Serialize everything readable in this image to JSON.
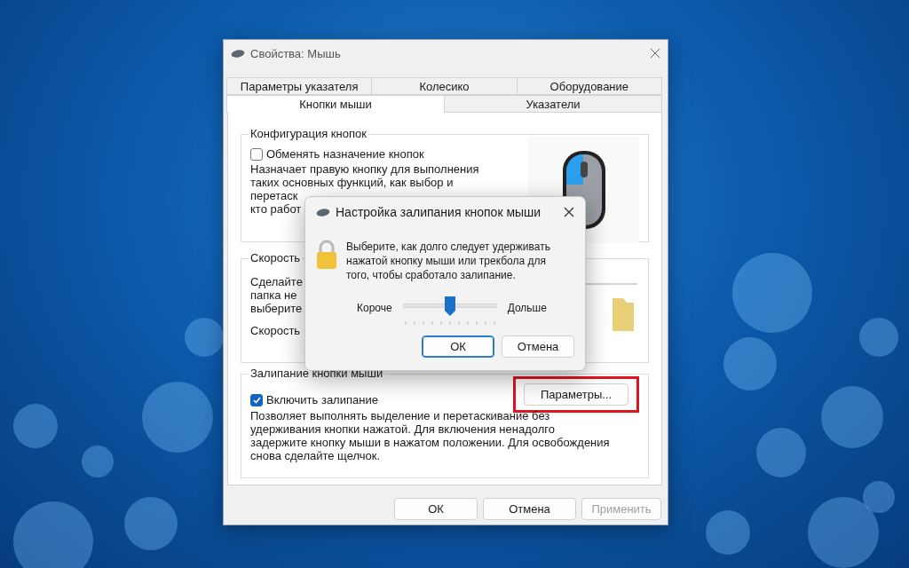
{
  "window": {
    "title": "Свойства: Мышь"
  },
  "tab_rows": [
    {
      "tabs": [
        {
          "label": "Параметры указателя",
          "selected": false
        },
        {
          "label": "Колесико",
          "selected": false
        },
        {
          "label": "Оборудование",
          "selected": false
        }
      ]
    },
    {
      "tabs": [
        {
          "label": "Кнопки мыши",
          "selected": true
        },
        {
          "label": "Указатели",
          "selected": false
        }
      ]
    }
  ],
  "button_config": {
    "legend": "Конфигурация кнопок",
    "checkbox": {
      "label": "Обменять назначение кнопок",
      "checked": false
    },
    "description_lines": [
      "Назначает правую кнопку для выполнения",
      "таких основных функций, как выбор и",
      "перетаск",
      "кто работ"
    ]
  },
  "speed": {
    "legend": "Скорость",
    "description_lines": [
      "Сделайте",
      "папка не",
      "выберите"
    ],
    "speed_label": "Скорость"
  },
  "clicklock": {
    "legend": "Залипание кнопки мыши",
    "checkbox": {
      "label": "Включить залипание",
      "checked": true
    },
    "settings_button": {
      "label": "Параметры...",
      "highlighted": true
    },
    "description_lines": [
      "Позволяет выполнять выделение и перетаскивание без",
      "удерживания кнопки нажатой. Для включения ненадолго",
      "задержите кнопку мыши в нажатом положении. Для освобождения",
      "снова сделайте щелчок."
    ]
  },
  "buttons": [
    {
      "label": "ОК",
      "disabled": false
    },
    {
      "label": "Отмена",
      "disabled": false
    },
    {
      "label": "Применить",
      "disabled": true
    }
  ],
  "dialog": {
    "title": "Настройка залипания кнопок мыши",
    "message_lines": [
      "Выберите, как долго следует удерживать",
      "нажатой кнопку мыши или трекбола для",
      "того, чтобы сработало залипание."
    ],
    "slider": {
      "min_label": "Короче",
      "max_label": "Дольше",
      "level": 0.5
    },
    "buttons": [
      {
        "label": "ОК",
        "default": true
      },
      {
        "label": "Отмена",
        "default": false
      }
    ]
  }
}
